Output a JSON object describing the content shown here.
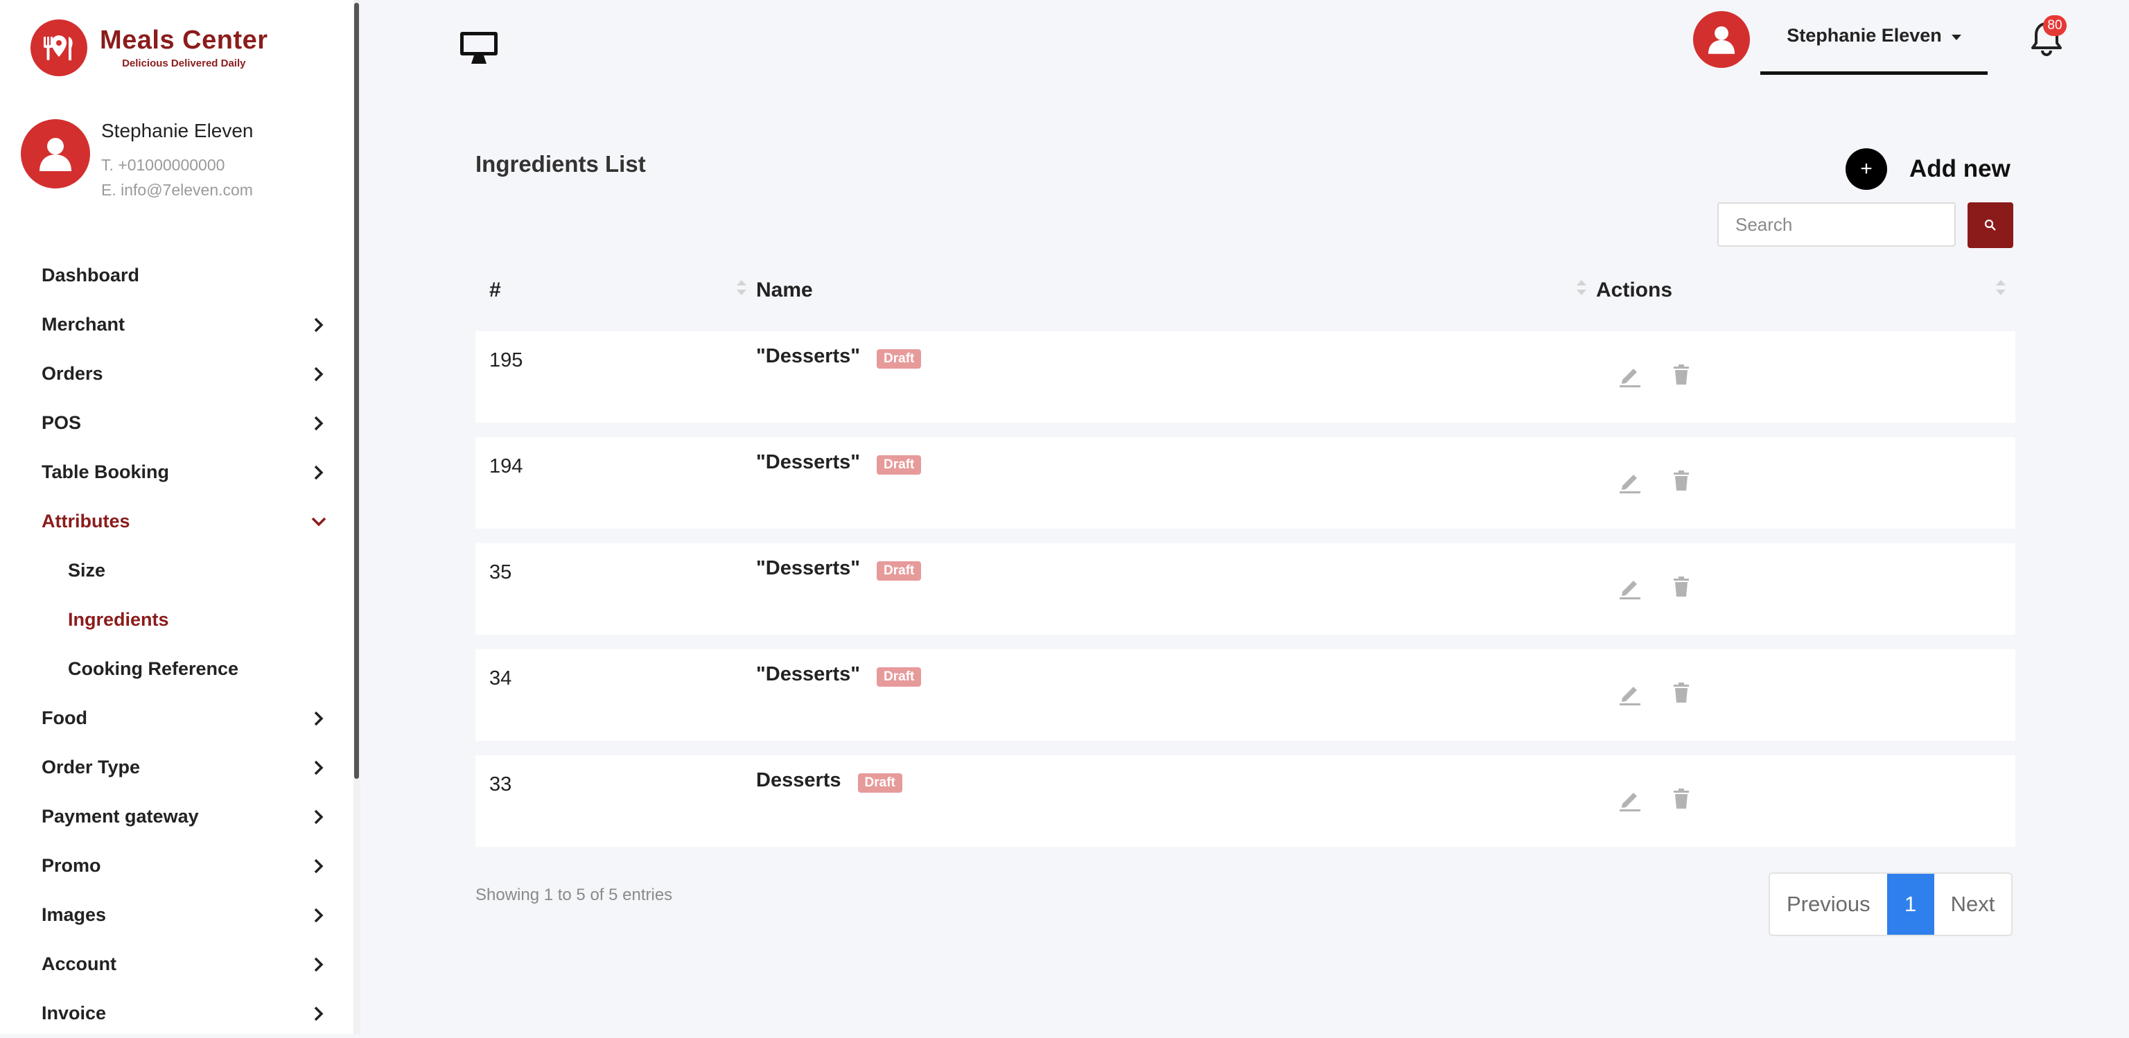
{
  "brand": {
    "name": "Meals Center",
    "tagline": "Delicious Delivered Daily"
  },
  "profile": {
    "name": "Stephanie Eleven",
    "phone": "T. +01000000000",
    "email": "E. info@7eleven.com"
  },
  "nav": {
    "items": [
      {
        "label": "Dashboard",
        "has_chevron": false
      },
      {
        "label": "Merchant",
        "has_chevron": true
      },
      {
        "label": "Orders",
        "has_chevron": true
      },
      {
        "label": "POS",
        "has_chevron": true
      },
      {
        "label": "Table Booking",
        "has_chevron": true
      },
      {
        "label": "Attributes",
        "has_chevron": true,
        "expanded": true,
        "active": true
      },
      {
        "label": "Food",
        "has_chevron": true
      },
      {
        "label": "Order Type",
        "has_chevron": true
      },
      {
        "label": "Payment gateway",
        "has_chevron": true
      },
      {
        "label": "Promo",
        "has_chevron": true
      },
      {
        "label": "Images",
        "has_chevron": true
      },
      {
        "label": "Account",
        "has_chevron": true
      },
      {
        "label": "Invoice",
        "has_chevron": true
      }
    ],
    "attributes_sub": [
      {
        "label": "Size"
      },
      {
        "label": "Ingredients",
        "active": true
      },
      {
        "label": "Cooking Reference"
      }
    ]
  },
  "topbar": {
    "user_name": "Stephanie Eleven",
    "notifications_count": "80"
  },
  "page": {
    "title": "Ingredients List",
    "add_new_label": "Add new",
    "add_new_symbol": "+",
    "search_placeholder": "Search"
  },
  "table": {
    "columns": [
      "#",
      "Name",
      "Actions"
    ],
    "rows": [
      {
        "id": "195",
        "name": "\"Desserts\"",
        "status": "Draft"
      },
      {
        "id": "194",
        "name": "\"Desserts\"",
        "status": "Draft"
      },
      {
        "id": "35",
        "name": "\"Desserts\"",
        "status": "Draft"
      },
      {
        "id": "34",
        "name": "\"Desserts\"",
        "status": "Draft"
      },
      {
        "id": "33",
        "name": "Desserts",
        "status": "Draft"
      }
    ],
    "info": "Showing 1 to 5 of 5 entries"
  },
  "pagination": {
    "previous": "Previous",
    "current": "1",
    "next": "Next"
  },
  "colors": {
    "brand_red": "#d32f2f",
    "active_nav": "#8b1c1c",
    "draft_badge": "#e79a9a",
    "page_current": "#2f80ed"
  }
}
